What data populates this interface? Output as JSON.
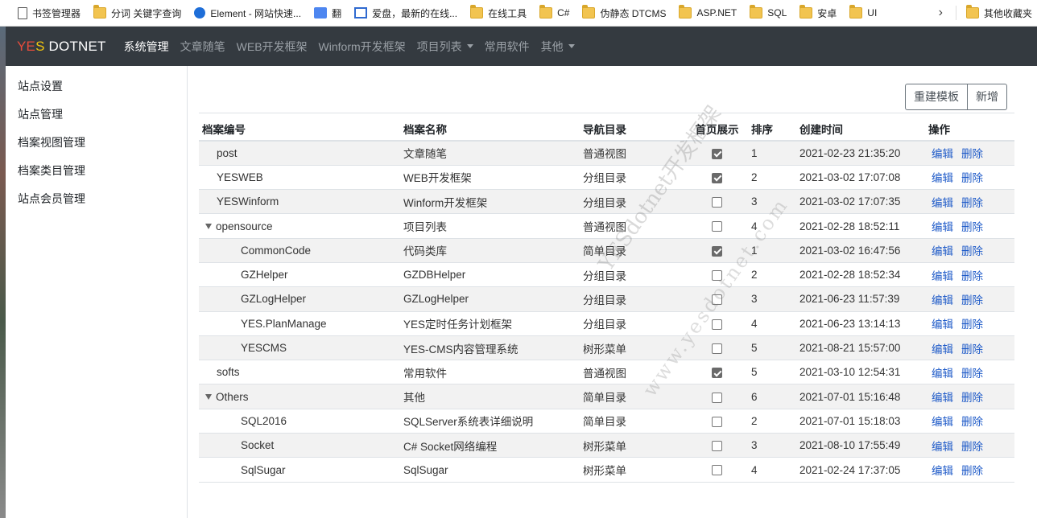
{
  "bookmarks": {
    "items": [
      {
        "label": "书签管理器",
        "icon": "bookmark-manager-icon"
      },
      {
        "label": "分词 关键字查询",
        "icon": "folder-icon"
      },
      {
        "label": "Element - 网站快速...",
        "icon": "element-globe-icon"
      },
      {
        "label": "翻",
        "icon": "translate-icon"
      },
      {
        "label": "爱盘，最新的在线...",
        "icon": "picture-icon"
      },
      {
        "label": "在线工具",
        "icon": "folder-icon"
      },
      {
        "label": "C#",
        "icon": "folder-icon"
      },
      {
        "label": "伪静态 DTCMS",
        "icon": "folder-icon"
      },
      {
        "label": "ASP.NET",
        "icon": "folder-icon"
      },
      {
        "label": "SQL",
        "icon": "folder-icon"
      },
      {
        "label": "安卓",
        "icon": "folder-icon"
      },
      {
        "label": "UI",
        "icon": "folder-icon"
      }
    ],
    "more": "›",
    "other": "其他收藏夹"
  },
  "navbar": {
    "brand_yes1": "YE",
    "brand_yes2": "S",
    "brand_rest": " DOTNET",
    "items": [
      {
        "label": "系统管理",
        "active": true,
        "dropdown": false
      },
      {
        "label": "文章随笔",
        "active": false,
        "dropdown": false
      },
      {
        "label": "WEB开发框架",
        "active": false,
        "dropdown": false
      },
      {
        "label": "Winform开发框架",
        "active": false,
        "dropdown": false
      },
      {
        "label": "项目列表",
        "active": false,
        "dropdown": true
      },
      {
        "label": "常用软件",
        "active": false,
        "dropdown": false
      },
      {
        "label": "其他",
        "active": false,
        "dropdown": true
      }
    ]
  },
  "sidebar": {
    "items": [
      "站点设置",
      "站点管理",
      "档案视图管理",
      "档案类目管理",
      "站点会员管理"
    ]
  },
  "toolbar": {
    "rebuild_label": "重建模板",
    "add_label": "新增"
  },
  "table": {
    "headers": [
      "档案编号",
      "档案名称",
      "导航目录",
      "首页展示",
      "排序",
      "创建时间",
      "操作"
    ],
    "edit_label": "编辑",
    "delete_label": "删除",
    "rows": [
      {
        "code": "post",
        "name": "文章随笔",
        "nav": "普通视图",
        "home": true,
        "sort": "1",
        "time": "2021-02-23 21:35:20",
        "level": 0,
        "toggle": false
      },
      {
        "code": "YESWEB",
        "name": "WEB开发框架",
        "nav": "分组目录",
        "home": true,
        "sort": "2",
        "time": "2021-03-02 17:07:08",
        "level": 0,
        "toggle": false
      },
      {
        "code": "YESWinform",
        "name": "Winform开发框架",
        "nav": "分组目录",
        "home": false,
        "sort": "3",
        "time": "2021-03-02 17:07:35",
        "level": 0,
        "toggle": false
      },
      {
        "code": "opensource",
        "name": "项目列表",
        "nav": "普通视图",
        "home": false,
        "sort": "4",
        "time": "2021-02-28 18:52:11",
        "level": 0,
        "toggle": true
      },
      {
        "code": "CommonCode",
        "name": "代码类库",
        "nav": "简单目录",
        "home": true,
        "sort": "1",
        "time": "2021-03-02 16:47:56",
        "level": 1,
        "toggle": false
      },
      {
        "code": "GZHelper",
        "name": "GZDBHelper",
        "nav": "分组目录",
        "home": false,
        "sort": "2",
        "time": "2021-02-28 18:52:34",
        "level": 1,
        "toggle": false
      },
      {
        "code": "GZLogHelper",
        "name": "GZLogHelper",
        "nav": "分组目录",
        "home": false,
        "sort": "3",
        "time": "2021-06-23 11:57:39",
        "level": 1,
        "toggle": false
      },
      {
        "code": "YES.PlanManage",
        "name": "YES定时任务计划框架",
        "nav": "分组目录",
        "home": false,
        "sort": "4",
        "time": "2021-06-23 13:14:13",
        "level": 1,
        "toggle": false
      },
      {
        "code": "YESCMS",
        "name": "YES-CMS内容管理系统",
        "nav": "树形菜单",
        "home": false,
        "sort": "5",
        "time": "2021-08-21 15:57:00",
        "level": 1,
        "toggle": false
      },
      {
        "code": "softs",
        "name": "常用软件",
        "nav": "普通视图",
        "home": true,
        "sort": "5",
        "time": "2021-03-10 12:54:31",
        "level": 0,
        "toggle": false
      },
      {
        "code": "Others",
        "name": "其他",
        "nav": "简单目录",
        "home": false,
        "sort": "6",
        "time": "2021-07-01 15:16:48",
        "level": 0,
        "toggle": true
      },
      {
        "code": "SQL2016",
        "name": "SQLServer系统表详细说明",
        "nav": "简单目录",
        "home": false,
        "sort": "2",
        "time": "2021-07-01 15:18:03",
        "level": 1,
        "toggle": false
      },
      {
        "code": "Socket",
        "name": "C# Socket网络编程",
        "nav": "树形菜单",
        "home": false,
        "sort": "3",
        "time": "2021-08-10 17:55:49",
        "level": 1,
        "toggle": false
      },
      {
        "code": "SqlSugar",
        "name": "SqlSugar",
        "nav": "树形菜单",
        "home": false,
        "sort": "4",
        "time": "2021-02-24 17:37:05",
        "level": 1,
        "toggle": false
      }
    ]
  },
  "watermark": {
    "line1": "YESdotnet开发框架",
    "line2": "www.yesdotnet.com"
  }
}
